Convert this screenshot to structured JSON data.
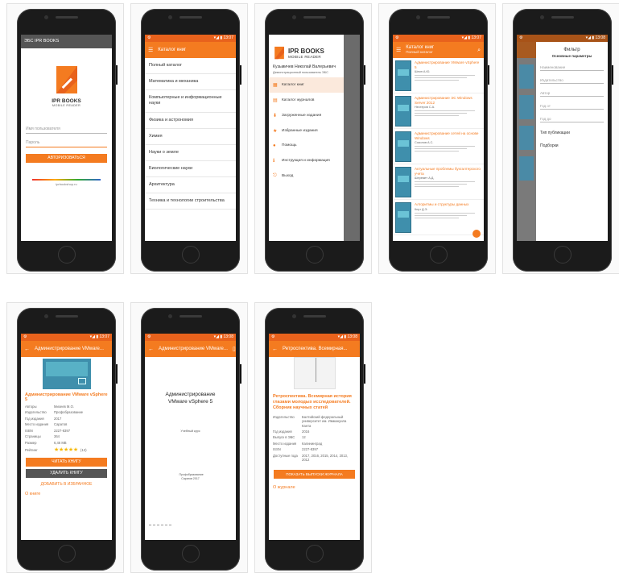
{
  "screens": {
    "login": {
      "status_title": "ЭБС IPR BOOKS",
      "logo_line1": "IPR BOOKS",
      "logo_line2": "MOBILE READER",
      "login_placeholder": "Имя пользователя",
      "password_placeholder": "Пароль",
      "login_button": "АВТОРИЗОВАТЬСЯ",
      "footer_text": "iprbookshop.ru"
    },
    "catalog": {
      "title": "Каталог книг",
      "items": [
        "Полный каталог",
        "Математика и механика",
        "Компьютерные и информационные науки",
        "Физика и астрономия",
        "Химия",
        "Науки о земле",
        "Биологические науки",
        "Архитектура",
        "Техника и технологии строительства"
      ]
    },
    "drawer": {
      "logo_line1": "IPR BOOKS",
      "logo_line2": "MOBILE READER",
      "user_name": "Кузьмичев Николай Валерьевич",
      "user_org": "Демонстрационный пользователь ЭБС",
      "items": [
        {
          "label": "Каталог книг",
          "icon": "book-icon"
        },
        {
          "label": "Каталог журналов",
          "icon": "journal-icon"
        },
        {
          "label": "Загруженные издания",
          "icon": "download-icon"
        },
        {
          "label": "Избранные издания",
          "icon": "star-icon"
        },
        {
          "label": "Помощь",
          "icon": "help-icon"
        },
        {
          "label": "Инструкция и информация",
          "icon": "info-icon"
        },
        {
          "label": "Выход",
          "icon": "exit-icon"
        }
      ]
    },
    "book_list": {
      "title": "Каталог книг",
      "subtitle": "Полный каталог",
      "books": [
        {
          "title": "Администрирование VMware vSphere 5",
          "author": "Шеин А.Ю."
        },
        {
          "title": "Администрирование ЭС Windows Server 2012",
          "author": "Нестеров С.А."
        },
        {
          "title": "Администрирование сетей на основе Windows",
          "author": "Соколов А.С."
        },
        {
          "title": "Актуальные проблемы бухгалтерского учета",
          "author": "Шеремет А.Д."
        },
        {
          "title": "Алгоритмы и структуры данных",
          "author": "Кнут Д.Э."
        }
      ]
    },
    "filter": {
      "title": "Фильтр",
      "subtitle": "Основные параметры",
      "fields": [
        "Наименование",
        "Издательство",
        "Автор",
        "Год от",
        "Год до"
      ],
      "pub_type_label": "Тип публикации",
      "collections_label": "Подборки"
    },
    "book_detail": {
      "title": "Администрирование VMware...",
      "book_title": "Администрирование VMware vSphere 5",
      "meta": [
        {
          "label": "Авторы",
          "value": "Михеев М.О."
        },
        {
          "label": "Издательство",
          "value": "Профобразование"
        },
        {
          "label": "Год издания",
          "value": "2017"
        },
        {
          "label": "Место издания",
          "value": "Саратов"
        },
        {
          "label": "ISBN",
          "value": "2227-8397"
        },
        {
          "label": "Страницы",
          "value": "364"
        },
        {
          "label": "Размер",
          "value": "6,46 MB"
        }
      ],
      "rating_label": "Рейтинг",
      "rating_value": 5,
      "rating_count": "(12)",
      "read_button": "ЧИТАТЬ КНИГУ",
      "delete_button": "УДАЛИТЬ КНИГУ",
      "favorite_button": "ДОБАВИТЬ В ИЗБРАННОЕ",
      "more_link": "О книге"
    },
    "reader": {
      "title": "Администрирование VMware...",
      "book_heading_line1": "Администрирование",
      "book_heading_line2": "VMware vSphere 5",
      "sub_text": "Учебный курс",
      "footer_text": "Профобразование Саратов 2017"
    },
    "journal": {
      "title": "Ретроспектива. Всемирная...",
      "journal_title": "Ретроспектива. Всемирная история глазами молодых исследователей. Сборник научных статей",
      "meta": [
        {
          "label": "Издательство",
          "value": "Балтийский федеральный университет им. Иммануила Канта"
        },
        {
          "label": "Год издания",
          "value": "2016"
        },
        {
          "label": "Выпуск в ЭБС",
          "value": "12"
        },
        {
          "label": "Место издания",
          "value": "Калининград"
        },
        {
          "label": "ISSN",
          "value": "2227-8397"
        },
        {
          "label": "Доступные года",
          "value": "2017, 2016, 2015, 2014, 2013, 2012"
        }
      ],
      "show_issues_button": "ПОКАЗАТЬ ВЫПУСКИ ЖУРНАЛА",
      "more_link": "О журнале"
    }
  },
  "colors": {
    "accent": "#f47b20",
    "status": "#e8621c",
    "bezel": "#1b1b1b"
  }
}
